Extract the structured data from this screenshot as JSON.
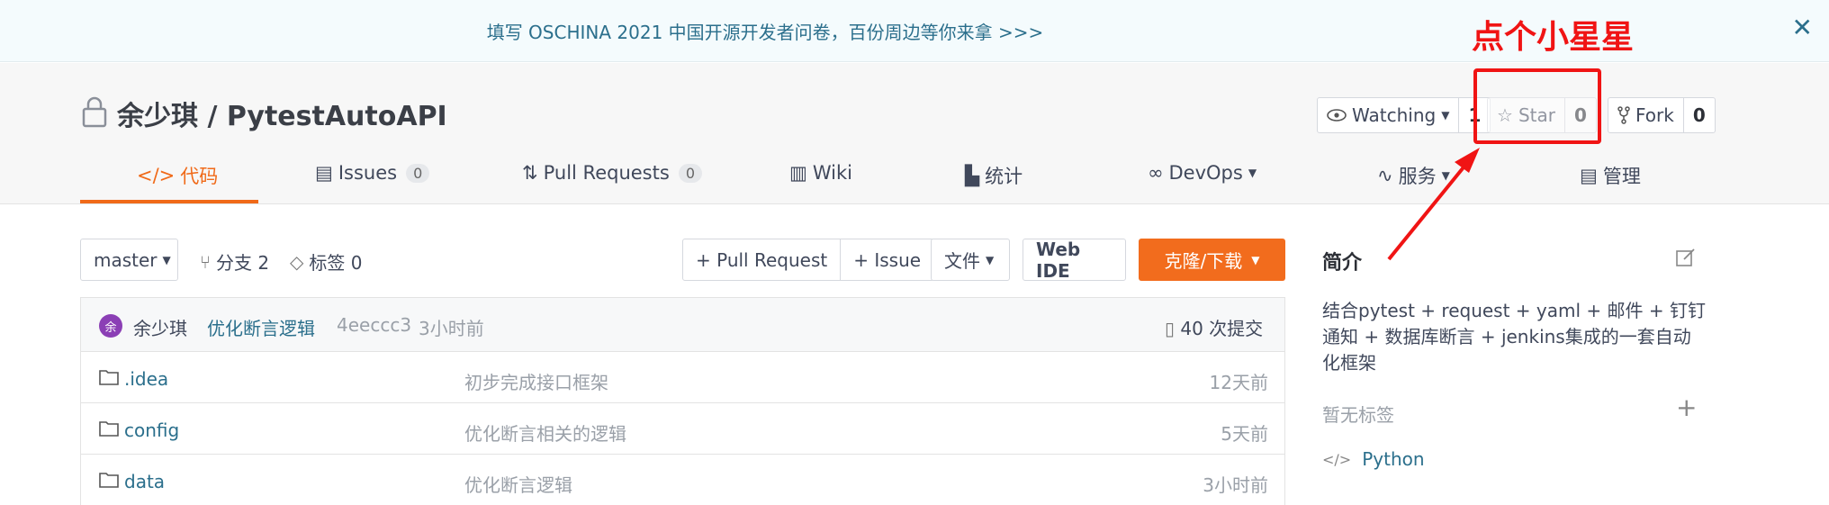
{
  "banner": {
    "text": "填写 OSCHINA 2021 中国开源开发者问卷，百份周边等你来拿 >>>",
    "close": "✕"
  },
  "annotation": {
    "text": "点个小星星"
  },
  "repo": {
    "owner": "余少琪",
    "separator": "/",
    "name": "PytestAutoAPI",
    "title": "余少琪 / PytestAutoAPI"
  },
  "actions": {
    "watching_label": "Watching",
    "watching_count": "1",
    "star_label": "Star",
    "star_count": "0",
    "fork_label": "Fork",
    "fork_count": "0"
  },
  "tabs": [
    {
      "label": "代码"
    },
    {
      "label": "Issues",
      "count": "0"
    },
    {
      "label": "Pull Requests",
      "count": "0"
    },
    {
      "label": "Wiki"
    },
    {
      "label": "统计"
    },
    {
      "label": "DevOps"
    },
    {
      "label": "服务"
    },
    {
      "label": "管理"
    }
  ],
  "toolbar": {
    "branch": "master",
    "branches": "分支 2",
    "tags": "标签 0",
    "pull_request": "+ Pull Request",
    "issue": "+ Issue",
    "files": "文件",
    "web_ide": "Web IDE",
    "clone": "克隆/下载"
  },
  "commit": {
    "avatar_char": "余",
    "author": "余少琪",
    "message": "优化断言逻辑",
    "hash": "4eeccc3",
    "time": "3小时前",
    "total": "40 次提交"
  },
  "files": [
    {
      "name": ".idea",
      "message": "初步完成接口框架",
      "time": "12天前"
    },
    {
      "name": "config",
      "message": "优化断言相关的逻辑",
      "time": "5天前"
    },
    {
      "name": "data",
      "message": "优化断言逻辑",
      "time": "3小时前"
    }
  ],
  "sidebar": {
    "intro_title": "简介",
    "description": "结合pytest + request + yaml + 邮件 + 钉钉通知 + 数据库断言 + jenkins集成的一套自动化框架",
    "description_lines": [
      "结合pytest + request + yaml + 邮件 + 钉钉",
      "通知 + 数据库断言 + jenkins集成的一套自动",
      "化框架"
    ],
    "no_tags": "暂无标签",
    "add": "+",
    "language": "Python"
  },
  "colors": {
    "accent": "#f06a19",
    "annotation": "#f01414",
    "link": "#2b6f8c"
  }
}
